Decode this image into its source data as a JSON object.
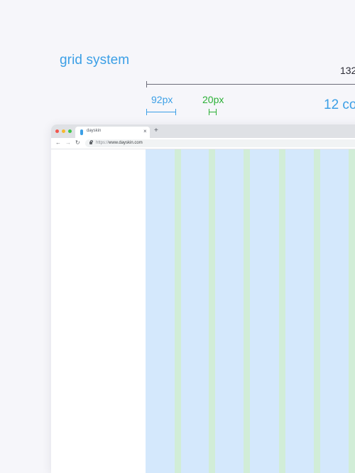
{
  "page": {
    "title": "grid system",
    "total_width_label": "132",
    "column_width_label": "92px",
    "gutter_width_label": "20px",
    "columns_label": "12 col",
    "colors": {
      "background": "#f6f6fa",
      "column_blue": "#3b9fe6",
      "gutter_green": "#2bb036",
      "column_fill": "#d4e8fc",
      "gutter_fill": "#d1edd7"
    }
  },
  "browser": {
    "tab_title": "dayskin",
    "tab_close_icon": "close-icon",
    "new_tab_icon": "plus-icon",
    "url_scheme": "https://",
    "url_host": "www.dayskin.com",
    "nav_icons": [
      "back-arrow-icon",
      "forward-arrow-icon",
      "reload-icon",
      "lock-icon"
    ],
    "traffic_lights": [
      "#f2564e",
      "#f7b82f",
      "#3ec54a"
    ]
  }
}
